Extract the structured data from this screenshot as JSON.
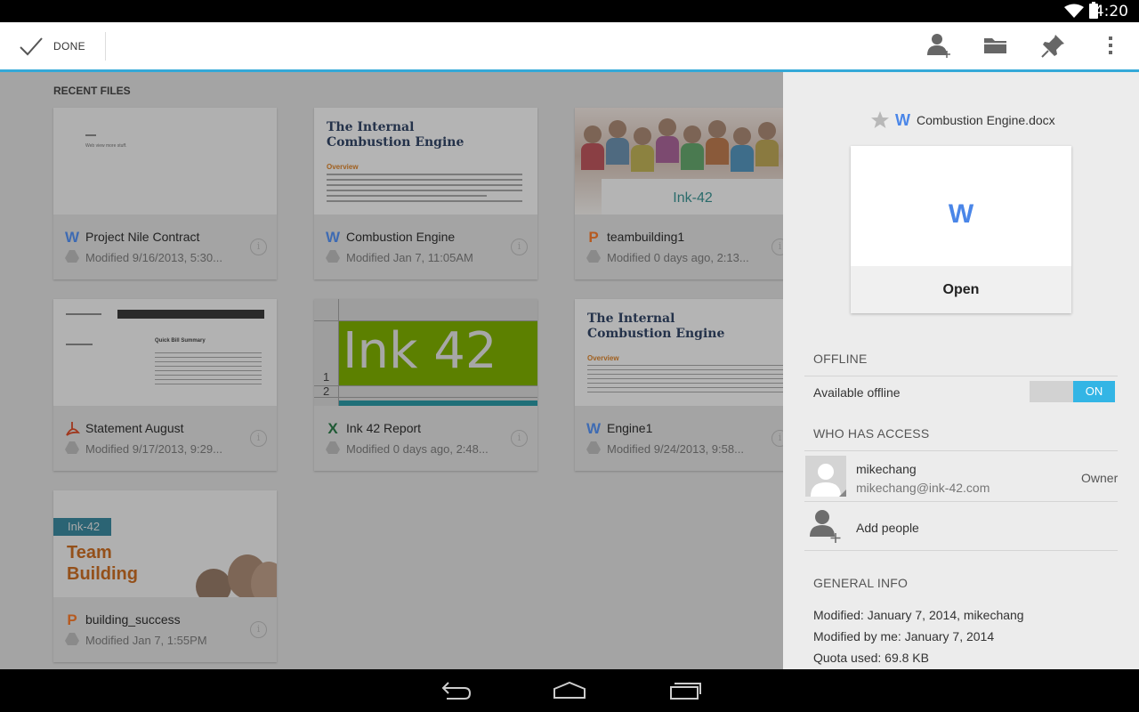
{
  "status_bar": {
    "time": "4:20"
  },
  "action_bar": {
    "done_label": "DONE",
    "icons": [
      "add-person-icon",
      "folder-icon",
      "pin-icon",
      "overflow-menu-icon"
    ]
  },
  "recent": {
    "heading": "RECENT FILES",
    "files": [
      {
        "name": "Project Nile Contract",
        "modified": "Modified 9/16/2013, 5:30...",
        "type": "word",
        "type_letter": "W",
        "thumb_line": "Web view more stuff."
      },
      {
        "name": "Combustion Engine",
        "modified": "Modified Jan 7, 11:05AM",
        "type": "word",
        "type_letter": "W",
        "thumb_title": "The Internal Combustion Engine",
        "thumb_sub": "Overview"
      },
      {
        "name": "teambuilding1",
        "modified": "Modified 0 days ago, 2:13...",
        "type": "ppt",
        "type_letter": "P",
        "thumb_banner": "Ink-42"
      },
      {
        "name": "Statement August",
        "modified": "Modified 9/17/2013, 9:29...",
        "type": "pdf",
        "type_letter": "pdf",
        "thumb_heading": "Quick Bill Summary"
      },
      {
        "name": "Ink 42 Report",
        "modified": "Modified 0 days ago, 2:48...",
        "type": "excel",
        "type_letter": "X",
        "thumb_text": "Ink 42",
        "row_numbers": [
          "1",
          "2"
        ]
      },
      {
        "name": "Engine1",
        "modified": "Modified 9/24/2013, 9:58...",
        "type": "word",
        "type_letter": "W",
        "thumb_title": "The Internal Combustion Engine",
        "thumb_sub": "Overview"
      },
      {
        "name": "building_success",
        "modified": "Modified Jan 7, 1:55PM",
        "type": "ppt",
        "type_letter": "P",
        "thumb_tag": "Ink-42",
        "thumb_title": "Team Building"
      }
    ]
  },
  "details": {
    "file_name": "Combustion Engine.docx",
    "file_icon_letter": "W",
    "open_label": "Open",
    "offline_heading": "OFFLINE",
    "available_offline_label": "Available offline",
    "toggle_label": "ON",
    "access_heading": "WHO HAS ACCESS",
    "user": {
      "name": "mikechang",
      "email": "mikechang@ink-42.com",
      "role": "Owner"
    },
    "add_people_label": "Add people",
    "general_heading": "GENERAL INFO",
    "modified": "Modified: January 7, 2014, mikechang",
    "modified_by_me": "Modified by me: January 7, 2014",
    "quota": "Quota used: 69.8 KB"
  },
  "colors": {
    "accent": "#33b5e5",
    "word": "#4a86e8",
    "ppt": "#d35400",
    "excel": "#1e7145",
    "pdf": "#c0392b"
  }
}
